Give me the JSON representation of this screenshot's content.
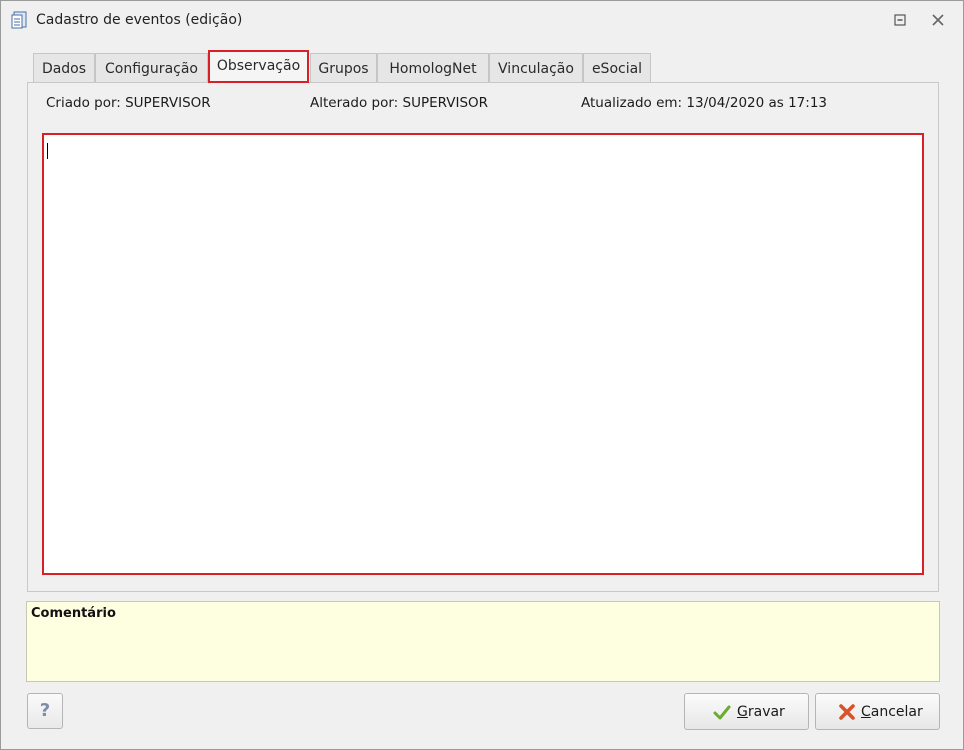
{
  "window": {
    "title": "Cadastro de eventos (edição)"
  },
  "tabs": [
    {
      "label": "Dados",
      "active": false
    },
    {
      "label": "Configuração",
      "active": false
    },
    {
      "label": "Observação",
      "active": true
    },
    {
      "label": "Grupos",
      "active": false
    },
    {
      "label": "HomologNet",
      "active": false
    },
    {
      "label": "Vinculação",
      "active": false
    },
    {
      "label": "eSocial",
      "active": false
    }
  ],
  "meta": {
    "created": "Criado por: SUPERVISOR",
    "altered": "Alterado por: SUPERVISOR",
    "updated": "Atualizado em: 13/04/2020 as 17:13"
  },
  "observation": {
    "value": ""
  },
  "comment": {
    "title": "Comentário"
  },
  "buttons": {
    "help": "?",
    "save_first": "G",
    "save_rest": "ravar",
    "cancel_first": "C",
    "cancel_rest": "ancelar"
  },
  "colors": {
    "highlight": "#d92027",
    "comment_bg": "#fefee0",
    "window_bg": "#f0f0f0"
  }
}
